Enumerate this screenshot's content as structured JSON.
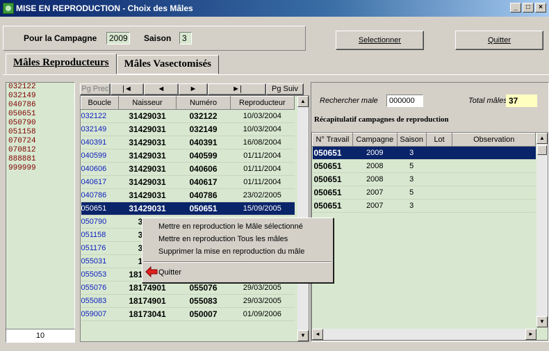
{
  "window": {
    "title": "MISE EN REPRODUCTION - Choix des Mâles",
    "min": "_",
    "max": "□",
    "close": "×"
  },
  "header": {
    "campagne_label": "Pour la Campagne",
    "campagne_value": "2009",
    "saison_label": "Saison",
    "saison_value": "3",
    "select_button": "Selectionner",
    "quit_button": "Quitter"
  },
  "tabs": [
    {
      "label": "Mâles Reproducteurs",
      "active": true
    },
    {
      "label": "Mâles Vasectomisés",
      "active": false
    }
  ],
  "left_list": {
    "items": [
      "032122",
      "032149",
      "040786",
      "050651",
      "050790",
      "051158",
      "070724",
      "070812",
      "888881",
      "999999"
    ],
    "count": "10"
  },
  "nav": {
    "prev": "Pg Prec",
    "first": "|◄",
    "back": "◄",
    "forward": "►",
    "last": "►|",
    "next": "Pg Suiv"
  },
  "main_table": {
    "columns": [
      "Boucle",
      "Naisseur",
      "Numéro",
      "Reproducteur"
    ],
    "rows": [
      [
        "032122",
        "31429031",
        "032122",
        "10/03/2004"
      ],
      [
        "032149",
        "31429031",
        "032149",
        "10/03/2004"
      ],
      [
        "040391",
        "31429031",
        "040391",
        "16/08/2004"
      ],
      [
        "040599",
        "31429031",
        "040599",
        "01/11/2004"
      ],
      [
        "040606",
        "31429031",
        "040606",
        "01/11/2004"
      ],
      [
        "040617",
        "31429031",
        "040617",
        "01/11/2004"
      ],
      [
        "040786",
        "31429031",
        "040786",
        "23/02/2005"
      ],
      [
        "050651",
        "31429031",
        "050651",
        "15/09/2005"
      ],
      [
        "050790",
        "3142",
        "",
        ""
      ],
      [
        "051158",
        "3142",
        "",
        ""
      ],
      [
        "051176",
        "3142",
        "",
        ""
      ],
      [
        "055031",
        "1817",
        "",
        ""
      ],
      [
        "055053",
        "18174901",
        "055053",
        "29/03/2005"
      ],
      [
        "055076",
        "18174901",
        "055076",
        "29/03/2005"
      ],
      [
        "055083",
        "18174901",
        "055083",
        "29/03/2005"
      ],
      [
        "059007",
        "18173041",
        "050007",
        "01/09/2006"
      ]
    ],
    "selected_index": 7
  },
  "context_menu": {
    "items": [
      "Mettre en reproduction le Mâle sélectionné",
      "Mettre en reproduction Tous les mâles",
      "Supprimer la mise en reproduction du mâle"
    ],
    "quit": "Quitter"
  },
  "right": {
    "search_label": "Rechercher male",
    "search_value": "000000",
    "total_label": "Total mâles",
    "total_value": "37",
    "recap_title": "Récapitulatif campagnes de reproduction",
    "columns": [
      "N° Travail",
      "Campagne",
      "Saison",
      "Lot",
      "Observation"
    ],
    "rows": [
      [
        "050651",
        "2009",
        "3",
        "",
        ""
      ],
      [
        "050651",
        "2008",
        "5",
        "",
        ""
      ],
      [
        "050651",
        "2008",
        "3",
        "",
        ""
      ],
      [
        "050651",
        "2007",
        "5",
        "",
        ""
      ],
      [
        "050651",
        "2007",
        "3",
        "",
        ""
      ]
    ],
    "selected_index": 0
  },
  "colors": {
    "title_bar": "#0a246a",
    "grid_bg": "#d8e8d0",
    "selection": "#0a246a",
    "left_list_text": "#800000",
    "boucle_text": "#1020c0"
  }
}
